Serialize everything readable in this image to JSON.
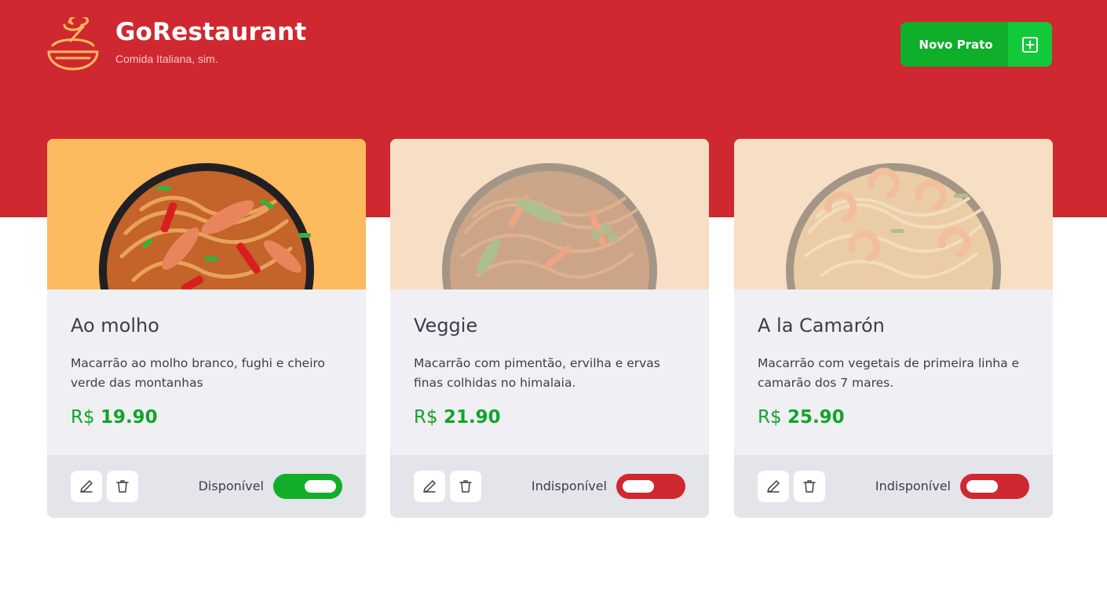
{
  "header": {
    "logo_icon": "bowl-icon",
    "title": "GoRestaurant",
    "subtitle": "Comida Italiana, sim.",
    "new_button_label": "Novo Prato",
    "new_button_icon": "plus-square-icon"
  },
  "colors": {
    "brand_red": "#cf2830",
    "green": "#0fae2b",
    "card_bg": "#f0f0f4",
    "footer_bg": "#e4e4eb"
  },
  "dishes": [
    {
      "name": "Ao molho",
      "description": "Macarrão ao molho branco, fughi e cheiro verde das montanhas",
      "currency": "R$",
      "price": "19.90",
      "status_label": "Disponível",
      "available": true,
      "image_bg": "#fdba5e"
    },
    {
      "name": "Veggie",
      "description": "Macarrão com pimentão, ervilha e ervas finas colhidas no himalaia.",
      "currency": "R$",
      "price": "21.90",
      "status_label": "Indisponível",
      "available": false,
      "image_bg": "#f6dfc4"
    },
    {
      "name": "A la Camarón",
      "description": "Macarrão com vegetais de primeira linha e camarão dos 7 mares.",
      "currency": "R$",
      "price": "25.90",
      "status_label": "Indisponível",
      "available": false,
      "image_bg": "#f6dfc4"
    }
  ]
}
